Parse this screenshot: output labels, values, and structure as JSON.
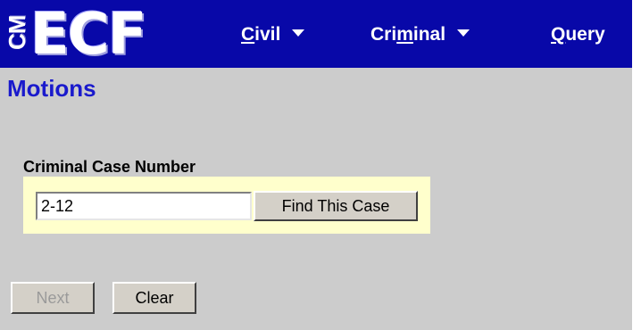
{
  "app": {
    "logo": {
      "small_text": "CM",
      "main_text": "ECF"
    }
  },
  "nav": {
    "items": [
      {
        "label_pre": "",
        "label_ul": "C",
        "label_post": "ivil",
        "has_dropdown": true
      },
      {
        "label_pre": "Cri",
        "label_ul": "m",
        "label_post": "inal",
        "has_dropdown": true
      },
      {
        "label_pre": "",
        "label_ul": "Q",
        "label_post": "uery",
        "has_dropdown": false
      }
    ]
  },
  "page": {
    "title": "Motions"
  },
  "case_search": {
    "label": "Criminal Case Number",
    "input_value": "2-12",
    "find_button_label": "Find This Case"
  },
  "actions": {
    "next_label": "Next",
    "next_disabled": true,
    "clear_label": "Clear"
  },
  "colors": {
    "topbar_bg": "#0808a8",
    "page_bg": "#cccccc",
    "title_color": "#1a1acc",
    "case_box_bg": "#ffffcc",
    "button_face": "#d4d0c8"
  }
}
